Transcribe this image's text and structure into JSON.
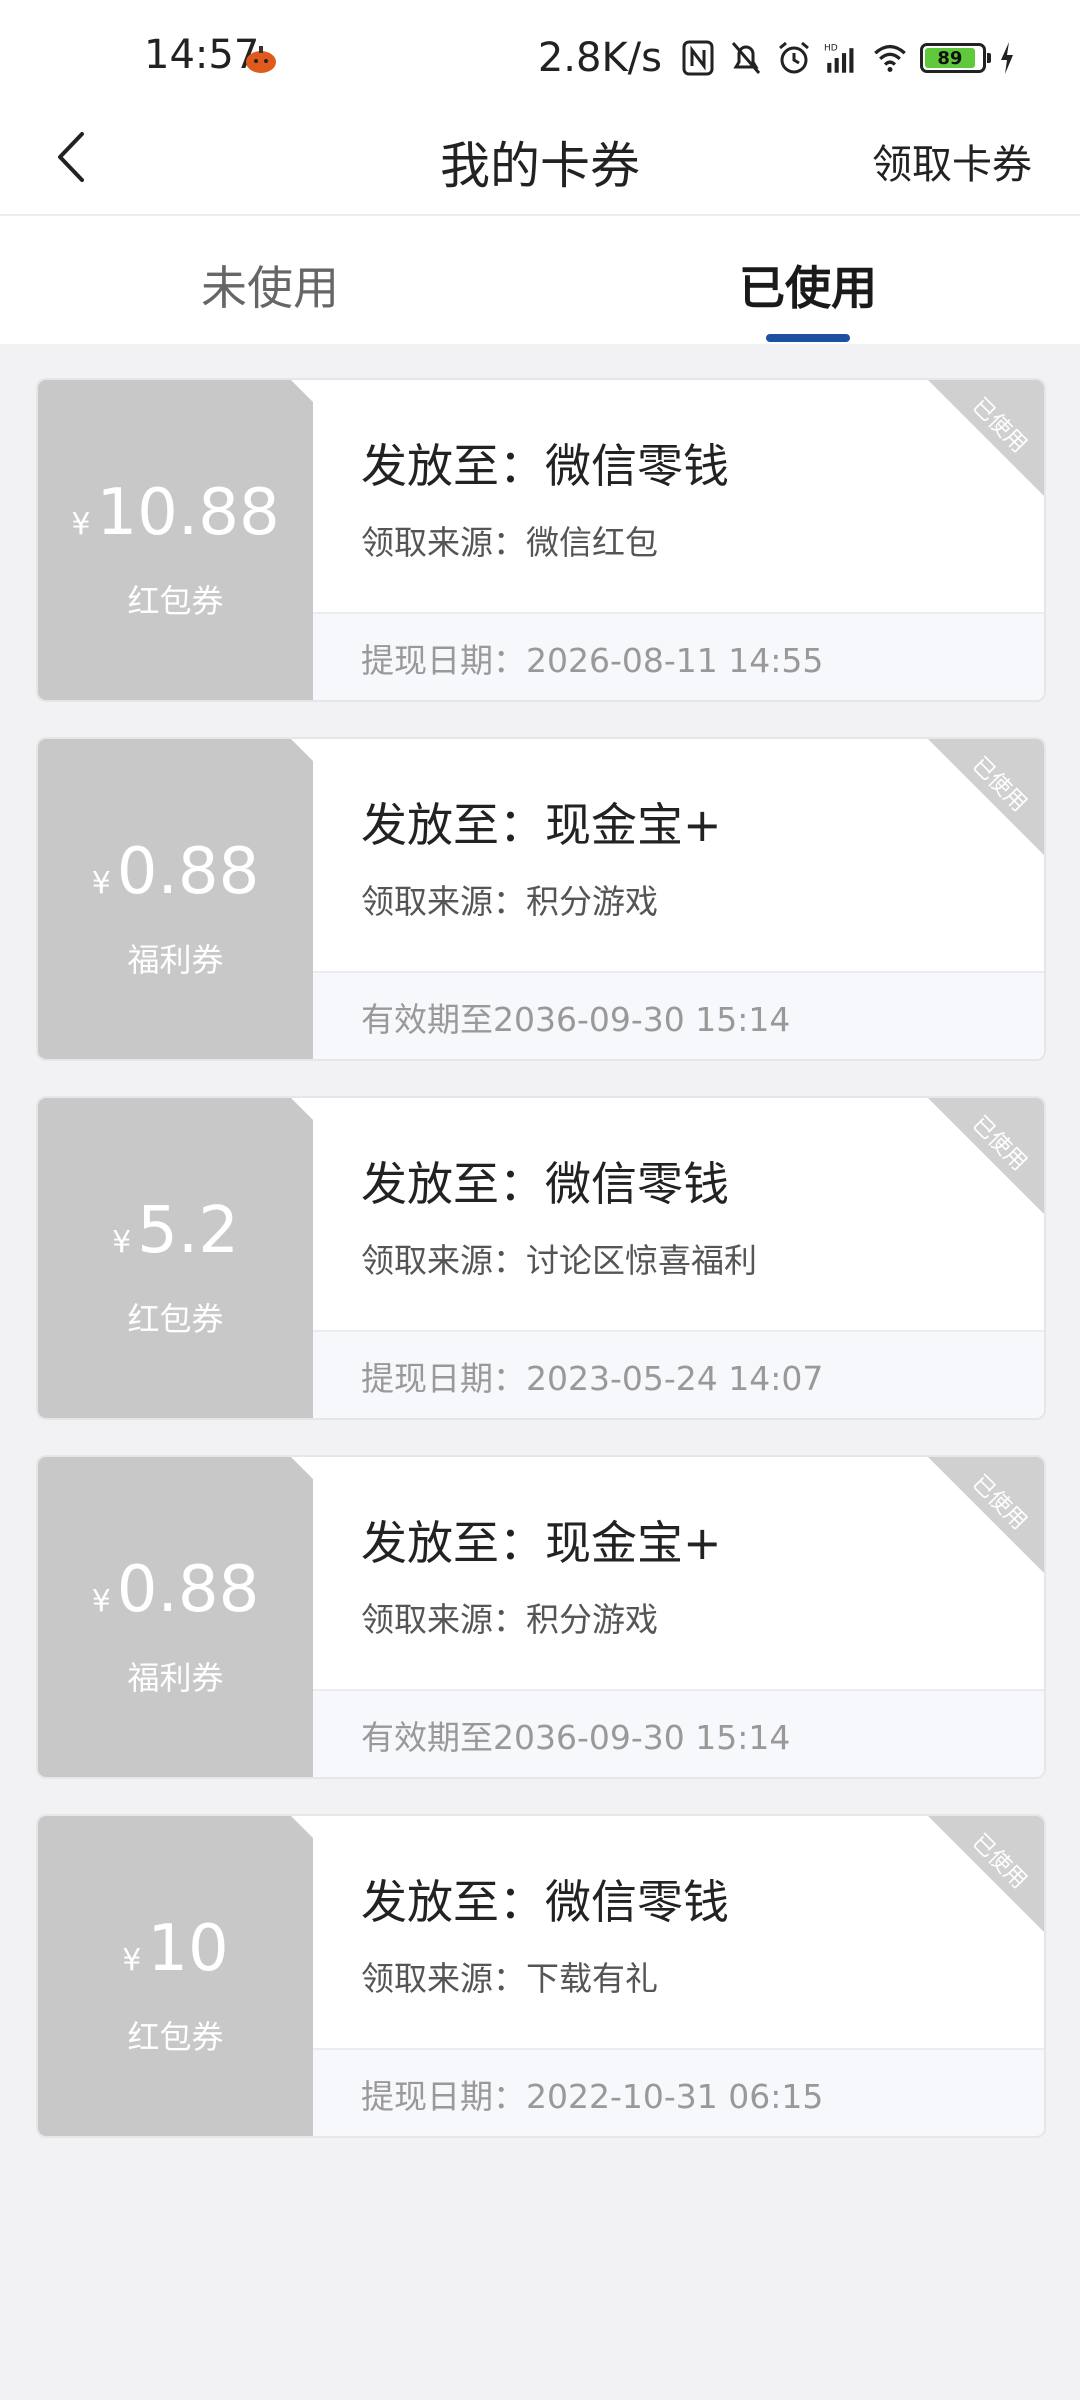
{
  "status": {
    "time": "14:57",
    "speed": "2.8K/s",
    "battery": "89"
  },
  "nav": {
    "title": "我的卡券",
    "right_action": "领取卡券"
  },
  "tabs": {
    "unused": "未使用",
    "used": "已使用"
  },
  "colors": {
    "accent": "#1d4fa3",
    "card_left": "#c8c8c8",
    "battery": "#5ec93a"
  },
  "cards": [
    {
      "currency": "¥",
      "amount": "10.88",
      "type": "红包券",
      "issue": "发放至：微信零钱",
      "source": "领取来源：微信红包",
      "date": "提现日期：2026-08-11 14:55",
      "stamp": "已使用"
    },
    {
      "currency": "¥",
      "amount": "0.88",
      "type": "福利券",
      "issue": "发放至：现金宝+",
      "source": "领取来源：积分游戏",
      "date": "有效期至2036-09-30 15:14",
      "stamp": "已使用"
    },
    {
      "currency": "¥",
      "amount": "5.2",
      "type": "红包券",
      "issue": "发放至：微信零钱",
      "source": "领取来源：讨论区惊喜福利",
      "date": "提现日期：2023-05-24 14:07",
      "stamp": "已使用"
    },
    {
      "currency": "¥",
      "amount": "0.88",
      "type": "福利券",
      "issue": "发放至：现金宝+",
      "source": "领取来源：积分游戏",
      "date": "有效期至2036-09-30 15:14",
      "stamp": "已使用"
    },
    {
      "currency": "¥",
      "amount": "10",
      "type": "红包券",
      "issue": "发放至：微信零钱",
      "source": "领取来源：下载有礼",
      "date": "提现日期：2022-10-31 06:15",
      "stamp": "已使用"
    }
  ]
}
